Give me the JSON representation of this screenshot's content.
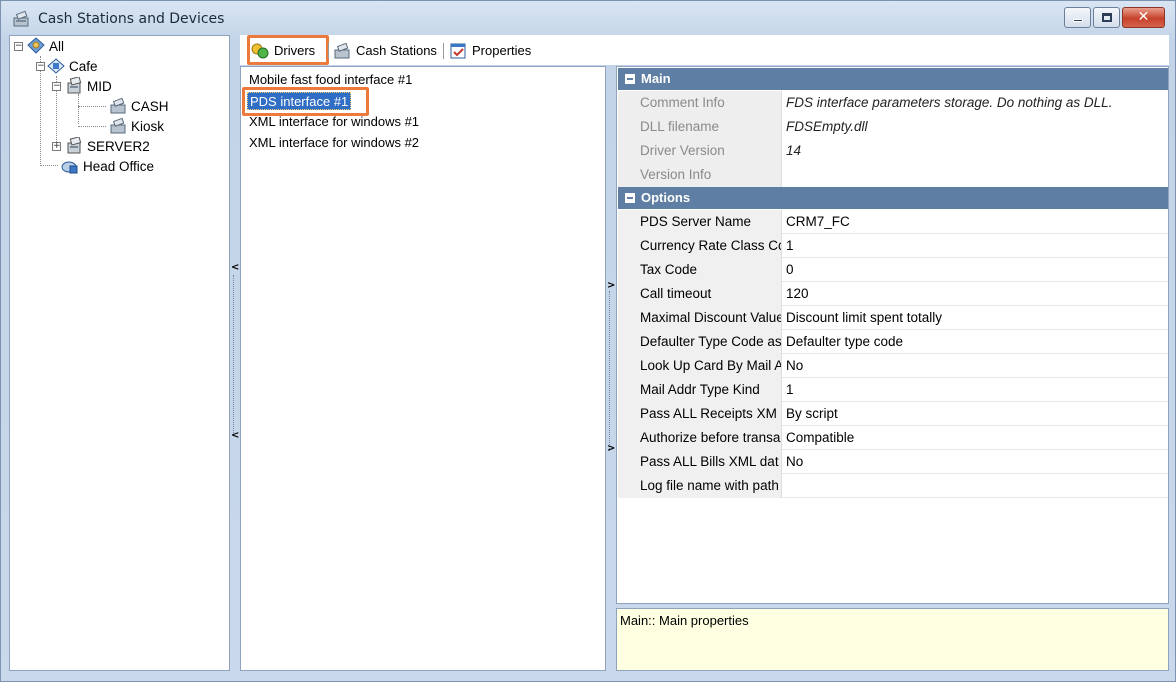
{
  "window": {
    "title": "Cash Stations and Devices",
    "min_glyph": "",
    "max_glyph": "",
    "close_glyph": "✕"
  },
  "tree": {
    "all": "All",
    "cafe": "Cafe",
    "mid": "MID",
    "cash": "CASH",
    "kiosk": "Kiosk",
    "server2": "SERVER2",
    "head_office": "Head Office",
    "expanded_glyph": "−",
    "collapsed_glyph": "+"
  },
  "toolbar": {
    "drivers": "Drivers",
    "cash_stations": "Cash Stations",
    "properties": "Properties"
  },
  "drivers_list": [
    "Mobile fast food interface #1",
    "PDS interface #1",
    "XML interface for windows #1",
    "XML interface for windows #2"
  ],
  "selected_driver": "PDS interface #1",
  "properties": {
    "main_label": "Main",
    "options_label": "Options",
    "main": [
      {
        "name": "Comment Info",
        "value": "FDS interface parameters storage. Do nothing as DLL."
      },
      {
        "name": "DLL filename",
        "value": "FDSEmpty.dll"
      },
      {
        "name": "Driver Version",
        "value": "14"
      },
      {
        "name": "Version Info",
        "value": ""
      }
    ],
    "options": [
      {
        "name": "PDS Server Name",
        "value": "CRM7_FC"
      },
      {
        "name": "Currency Rate Class Cc",
        "value": "1"
      },
      {
        "name": "Tax Code",
        "value": "0"
      },
      {
        "name": "Call timeout",
        "value": "120"
      },
      {
        "name": "Maximal Discount Value",
        "value": "Discount limit spent totally"
      },
      {
        "name": "Defaulter Type Code as",
        "value": "Defaulter type code"
      },
      {
        "name": "Look Up Card By Mail A",
        "value": "No"
      },
      {
        "name": "Mail Addr Type Kind",
        "value": "1"
      },
      {
        "name": "Pass ALL Receipts XM",
        "value": "By script"
      },
      {
        "name": "Authorize before transa",
        "value": "Compatible"
      },
      {
        "name": "Pass ALL Bills XML dat",
        "value": "No"
      },
      {
        "name": "Log file name with path",
        "value": ""
      }
    ]
  },
  "description": "Main:: Main properties",
  "splitter": {
    "collapse_left": "<",
    "collapse_right": ">"
  },
  "colors": {
    "accent_highlight": "#ec7a3d",
    "selection": "#2f6ec4",
    "category_header": "#5e7fa3",
    "description_bg": "#ffffe1"
  }
}
